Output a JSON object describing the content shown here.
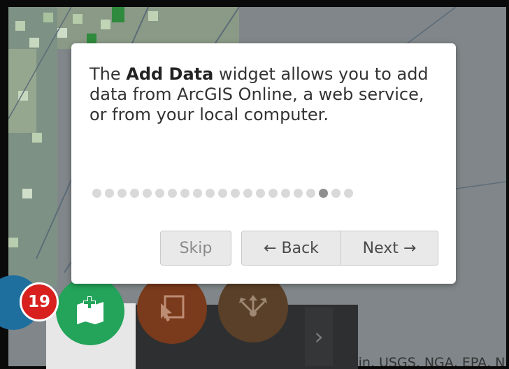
{
  "tour": {
    "text_before": "The ",
    "text_bold": "Add Data",
    "text_after": " widget allows you to add data from ArcGIS Online, a web service, or from your local computer.",
    "step_count": 21,
    "active_step": 19,
    "buttons": {
      "skip": "Skip",
      "back": "← Back",
      "next": "Next →"
    }
  },
  "widget_bar": {
    "badge": "19",
    "next_arrow": "›",
    "icons": [
      "unknown-widget-icon",
      "add-data-icon",
      "select-icon",
      "share-icon"
    ]
  },
  "map": {
    "attribution": "Sources: Esri, HERE, Garmin, USGS, NGA, EPA, NPS"
  },
  "colors": {
    "add_data": "#23a45a",
    "badge": "#d8201f",
    "active_dot": "#8f8f8f"
  }
}
